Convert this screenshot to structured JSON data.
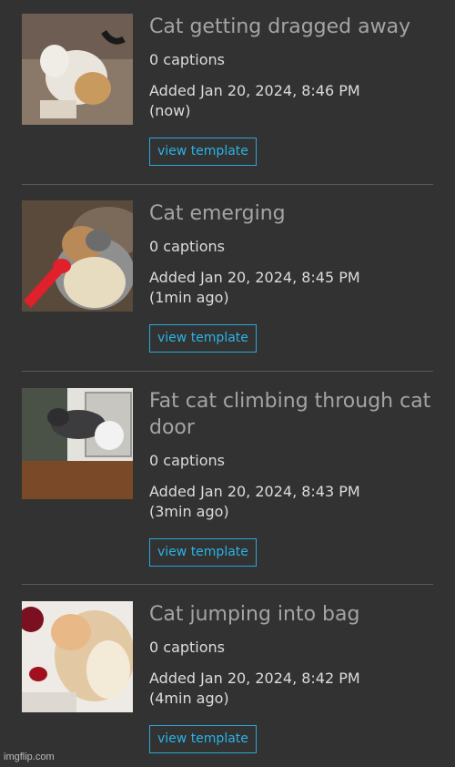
{
  "templates": [
    {
      "title": "Cat getting dragged away",
      "captions": "0 captions",
      "added": "Added Jan 20, 2024, 8:46 PM",
      "ago": "(now)",
      "button": "view template"
    },
    {
      "title": "Cat emerging",
      "captions": "0 captions",
      "added": "Added Jan 20, 2024, 8:45 PM",
      "ago": "(1min ago)",
      "button": "view template"
    },
    {
      "title": "Fat cat climbing through cat door",
      "captions": "0 captions",
      "added": "Added Jan 20, 2024, 8:43 PM",
      "ago": "(3min ago)",
      "button": "view template"
    },
    {
      "title": "Cat jumping into bag",
      "captions": "0 captions",
      "added": "Added Jan 20, 2024, 8:42 PM",
      "ago": "(4min ago)",
      "button": "view template"
    }
  ],
  "watermark": "imgflip.com",
  "colors": {
    "background": "#323232",
    "title": "#a4a4a4",
    "text": "#dcdcdc",
    "accent": "#29b4e6"
  }
}
